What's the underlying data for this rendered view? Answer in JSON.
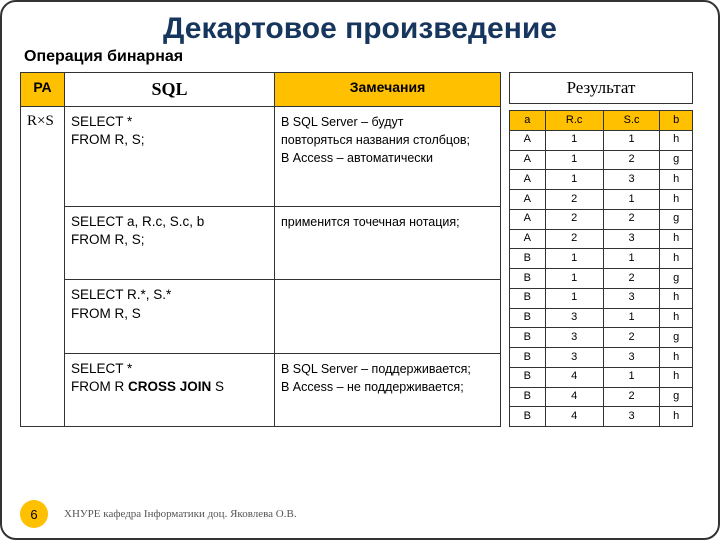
{
  "title": "Декартовое произведение",
  "subtitle": "Операция бинарная",
  "headers": {
    "ra": "РА",
    "sql": "SQL",
    "notes": "Замечания",
    "result": "Результат"
  },
  "ra_value": "R×S",
  "sql_rows": [
    {
      "sql_html": "SELECT *<br>FROM R, S;",
      "notes_html": "В SQL Server – будут<br>повторяться названия столбцов;<br>В Access – автоматически"
    },
    {
      "sql_html": "SELECT a, R.c, S.c, b<br>FROM R, S;",
      "notes_html": "применится точечная нотация;"
    },
    {
      "sql_html": "SELECT R.*, S.*<br>FROM R, S",
      "notes_html": ""
    },
    {
      "sql_html": "SELECT *<br>FROM R <b>CROSS JOIN</b> S",
      "notes_html": "В SQL Server – поддерживается;<br>В Access – не поддерживается;"
    }
  ],
  "result": {
    "columns": [
      "a",
      "R.c",
      "S.c",
      "b"
    ],
    "rows": [
      [
        "A",
        "1",
        "1",
        "h"
      ],
      [
        "A",
        "1",
        "2",
        "g"
      ],
      [
        "A",
        "1",
        "3",
        "h"
      ],
      [
        "A",
        "2",
        "1",
        "h"
      ],
      [
        "A",
        "2",
        "2",
        "g"
      ],
      [
        "A",
        "2",
        "3",
        "h"
      ],
      [
        "B",
        "1",
        "1",
        "h"
      ],
      [
        "B",
        "1",
        "2",
        "g"
      ],
      [
        "B",
        "1",
        "3",
        "h"
      ],
      [
        "B",
        "3",
        "1",
        "h"
      ],
      [
        "B",
        "3",
        "2",
        "g"
      ],
      [
        "B",
        "3",
        "3",
        "h"
      ],
      [
        "B",
        "4",
        "1",
        "h"
      ],
      [
        "B",
        "4",
        "2",
        "g"
      ],
      [
        "B",
        "4",
        "3",
        "h"
      ]
    ]
  },
  "footer": {
    "page": "6",
    "text": "ХНУРЕ кафедра Інформатики доц. Яковлева О.В."
  }
}
